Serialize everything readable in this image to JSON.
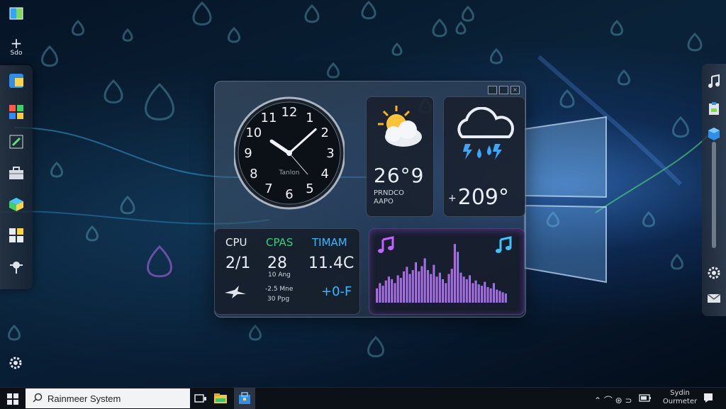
{
  "desktop": {
    "top_left_label": "Sdo",
    "wallpaper_accent": "#4f9cff"
  },
  "left_dock": {
    "icons": [
      "app-tile-icon",
      "color-picker-icon",
      "edit-icon",
      "toolbox-icon",
      "chart-icon",
      "grid-icon",
      "pin-icon"
    ]
  },
  "clock_widget": {
    "numerals": [
      "12",
      "1",
      "2",
      "3",
      "4",
      "5",
      "6",
      "7",
      "8",
      "9",
      "10",
      "11"
    ],
    "brand": "Tanlon",
    "time_hours": 10,
    "time_minutes": 8
  },
  "weather_card_1": {
    "icon": "partly-sunny-icon",
    "temperature": "26°9",
    "line1": "PRNDCO",
    "line2": "AAPO"
  },
  "weather_card_2": {
    "icon": "rain-thunder-icon",
    "prefix": "+",
    "temperature": "209°"
  },
  "stats_widget": {
    "col1": {
      "label": "CPU",
      "value": "2/1",
      "color": "#e9eef7"
    },
    "col2": {
      "label": "CPAS",
      "value": "28",
      "sub1": "10 Ang",
      "sub2": "-2.5 Mne",
      "sub3": "30 Ppg",
      "color": "#35d07a"
    },
    "col3": {
      "label": "TIMAM",
      "value": "11.4C",
      "extra": "+0-F",
      "color": "#3ab8ff"
    }
  },
  "music_widget": {
    "icon_left": "music-note-icon",
    "icon_right": "music-note-icon",
    "levels": [
      0.22,
      0.3,
      0.26,
      0.34,
      0.4,
      0.36,
      0.3,
      0.42,
      0.38,
      0.48,
      0.55,
      0.44,
      0.5,
      0.62,
      0.48,
      0.56,
      0.68,
      0.5,
      0.44,
      0.58,
      0.4,
      0.46,
      0.36,
      0.3,
      0.44,
      0.52,
      0.9,
      0.78,
      0.46,
      0.4,
      0.36,
      0.42,
      0.3,
      0.34,
      0.28,
      0.26,
      0.32,
      0.24,
      0.22,
      0.3,
      0.2,
      0.18,
      0.16,
      0.14
    ],
    "accent_colors": [
      "#ff3fa0",
      "#b055ff",
      "#3fd6ff"
    ]
  },
  "right_dock": {
    "icons": [
      "music-icon",
      "clipboard-icon",
      "cube-icon",
      "settings-icon",
      "mail-icon"
    ]
  },
  "taskbar": {
    "search_text": "Rainmeer System",
    "tray_glyphs": "⌃ ⌒ ⊛ ⊃",
    "clock_line1": "Sydin",
    "clock_line2": "Ourmeter"
  }
}
